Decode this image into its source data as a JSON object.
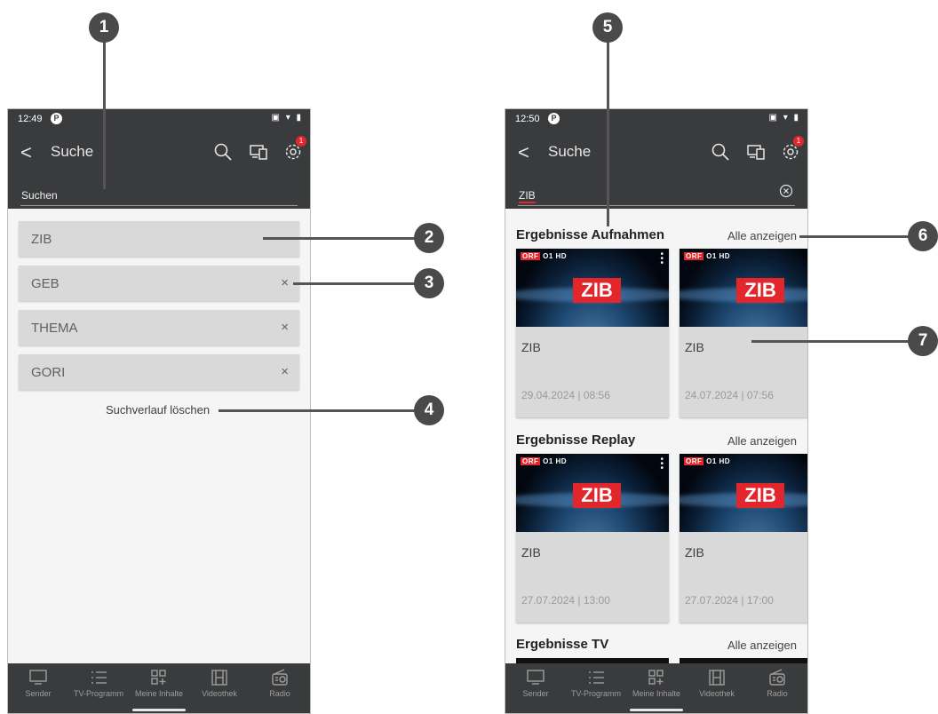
{
  "left": {
    "status": {
      "time": "12:49"
    },
    "appbar": {
      "back": "<",
      "title": "Suche",
      "badge": "1",
      "search_placeholder": "Suchen"
    },
    "history": [
      {
        "label": "ZIB",
        "x": ""
      },
      {
        "label": "GEB",
        "x": "×"
      },
      {
        "label": "THEMA",
        "x": "×"
      },
      {
        "label": "GORI",
        "x": "×"
      }
    ],
    "clear_history": "Suchverlauf löschen"
  },
  "right": {
    "status": {
      "time": "12:50"
    },
    "appbar": {
      "back": "<",
      "title": "Suche",
      "badge": "1",
      "search_text": "ZIB"
    },
    "sections": [
      {
        "title": "Ergebnisse Aufnahmen",
        "show_all": "Alle anzeigen",
        "cards": [
          {
            "title": "ZIB",
            "date": "29.04.2024 | 08:56"
          },
          {
            "title": "ZIB",
            "date": "24.07.2024 | 07:56"
          }
        ]
      },
      {
        "title": "Ergebnisse Replay",
        "show_all": "Alle anzeigen",
        "cards": [
          {
            "title": "ZIB",
            "date": "27.07.2024 | 13:00"
          },
          {
            "title": "ZIB",
            "date": "27.07.2024 | 17:00"
          }
        ]
      },
      {
        "title": "Ergebnisse TV",
        "show_all": "Alle anzeigen"
      }
    ]
  },
  "thumb": {
    "orf": "ORF",
    "o1": "O1",
    "hd": "HD",
    "zib": "ZIB"
  },
  "nav": [
    "Sender",
    "TV-Programm",
    "Meine Inhalte",
    "Videothek",
    "Radio"
  ],
  "callouts": [
    "1",
    "2",
    "3",
    "4",
    "5",
    "6",
    "7"
  ],
  "colors": {
    "appbar": "#3a3b3d",
    "accent_red": "#e3262b",
    "history_item": "#d9d9d9",
    "callout": "#4a4a4a"
  }
}
